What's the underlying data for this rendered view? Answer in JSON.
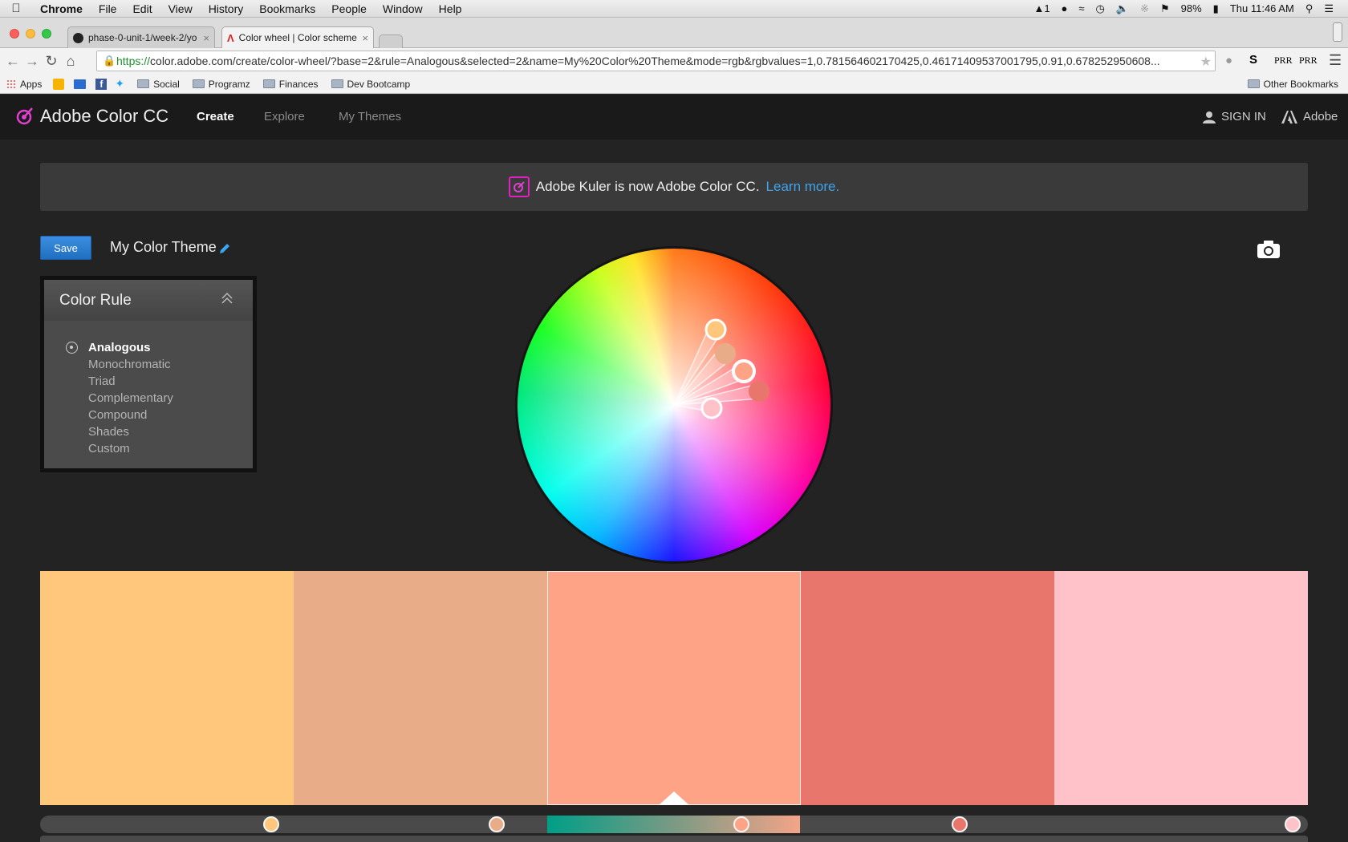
{
  "menubar": {
    "app": "Chrome",
    "items": [
      "File",
      "Edit",
      "View",
      "History",
      "Bookmarks",
      "People",
      "Window",
      "Help"
    ],
    "status_a": "1",
    "battery": "98%",
    "clock": "Thu 11:46 AM"
  },
  "tabs": [
    {
      "label": "phase-0-unit-1/week-2/yo",
      "active": false
    },
    {
      "label": "Color wheel | Color scheme",
      "active": true
    }
  ],
  "address": {
    "scheme": "https://",
    "rest": "color.adobe.com/create/color-wheel/?base=2&rule=Analogous&selected=2&name=My%20Color%20Theme&mode=rgb&rgbvalues=1,0.781564602170425,0.46171409537001795,0.91,0.678252950608..."
  },
  "extensions": {
    "a": "PRR",
    "b": "PRR"
  },
  "bookmarks": {
    "apps": "Apps",
    "folders": [
      "Social",
      "Programz",
      "Finances",
      "Dev Bootcamp"
    ],
    "other": "Other Bookmarks"
  },
  "header": {
    "brand": "Adobe Color CC",
    "nav": [
      "Create",
      "Explore",
      "My Themes"
    ],
    "active_nav": "Create",
    "sign_in": "SIGN IN",
    "adobe": "Adobe"
  },
  "banner": {
    "text": "Adobe Kuler is now Adobe Color CC.",
    "link": "Learn more."
  },
  "toolbar": {
    "save_label": "Save",
    "theme_name": "My Color Theme"
  },
  "color_rule": {
    "title": "Color Rule",
    "options": [
      "Analogous",
      "Monochromatic",
      "Triad",
      "Complementary",
      "Compound",
      "Shades",
      "Custom"
    ],
    "selected": "Analogous"
  },
  "theme": {
    "selected_index": 2,
    "swatches": [
      "#ffc77b",
      "#e8ac88",
      "#ffa386",
      "#e8766c",
      "#ffc2c9"
    ]
  },
  "sliders": {
    "knob_values": [
      0.182,
      0.36,
      0.553,
      0.725,
      0.988
    ]
  }
}
